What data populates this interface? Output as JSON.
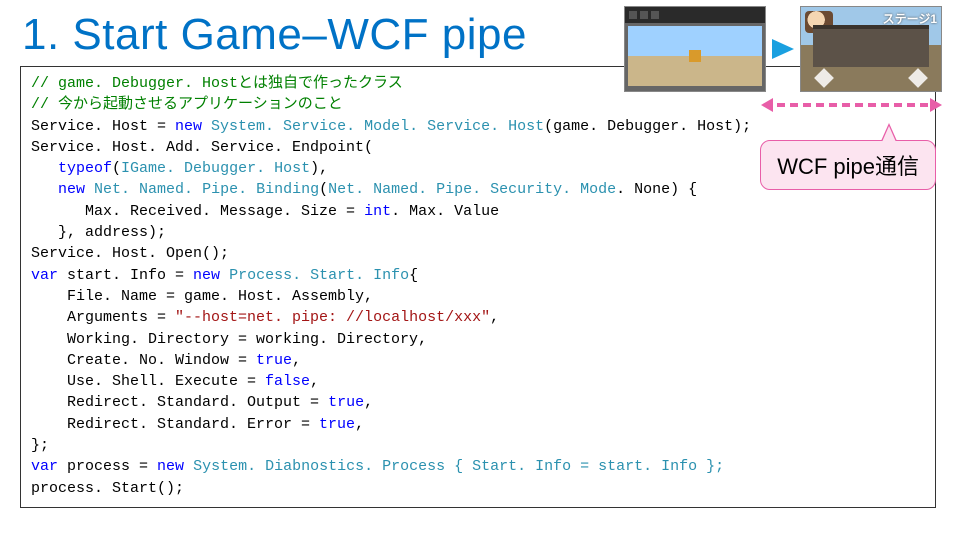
{
  "title": "1. Start Game–WCF pipe",
  "callout_text": "WCF pipe通信",
  "game_hud": "ステージ1",
  "code": {
    "c1": "// game. Debugger. Hostとは独自で作ったクラス",
    "c2": "// 今から起動させるアプリケーションのこと",
    "l3_a": "Service. Host = ",
    "l3_kw": "new",
    "l3_b": " System. Service. Model. Service. Host",
    "l3_c": "(game. Debugger. Host);",
    "l4": "Service. Host. Add. Service. Endpoint(",
    "l5_a": "   ",
    "l5_kw": "typeof",
    "l5_b": "(",
    "l5_t": "IGame. Debugger. Host",
    "l5_c": "),",
    "l6_a": "   ",
    "l6_kw": "new",
    "l6_b": " ",
    "l6_t1": "Net. Named. Pipe. Binding",
    "l6_c": "(",
    "l6_t2": "Net. Named. Pipe. Security. Mode",
    "l6_d": ". None) {",
    "l7_a": "      Max. Received. Message. Size = ",
    "l7_kw": "int",
    "l7_b": ". Max. Value",
    "l8": "   }, address);",
    "l9": "Service. Host. Open();",
    "l10_kw": "var",
    "l10_a": " start. Info = ",
    "l10_kw2": "new",
    "l10_b": " ",
    "l10_t": "Process. Start. Info",
    "l10_c": "{",
    "l11": "    File. Name = game. Host. Assembly,",
    "l12_a": "    Arguments = ",
    "l12_s": "\"--host=net. pipe: //localhost/xxx\"",
    "l12_b": ",",
    "l13": "    Working. Directory = working. Directory,",
    "l14_a": "    Create. No. Window = ",
    "l14_kw": "true",
    "l14_b": ",",
    "l15_a": "    Use. Shell. Execute = ",
    "l15_kw": "false",
    "l15_b": ",",
    "l16_a": "    Redirect. Standard. Output = ",
    "l16_kw": "true",
    "l16_b": ",",
    "l17_a": "    Redirect. Standard. Error = ",
    "l17_kw": "true",
    "l17_b": ",",
    "l18": "};",
    "l19_kw": "var",
    "l19_a": " process = ",
    "l19_kw2": "new",
    "l19_b": " System. Diabnostics. Process { Start. Info = start. Info };",
    "l20": "process. Start();"
  }
}
